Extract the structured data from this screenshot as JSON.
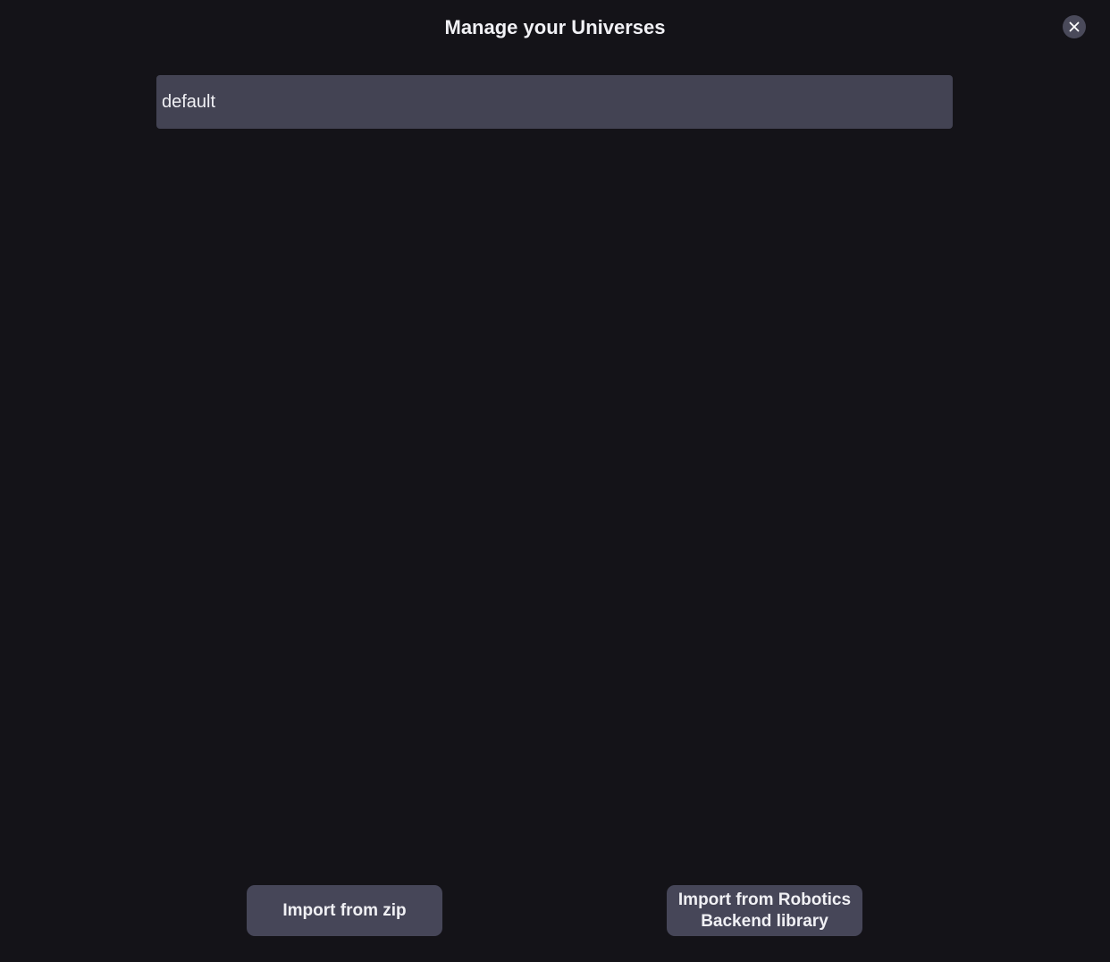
{
  "dialog": {
    "title": "Manage your Universes",
    "close_icon": "close-icon"
  },
  "universes": [
    {
      "name": "default"
    }
  ],
  "actions": {
    "import_zip_label": "Import from zip",
    "import_library_label": "Import from Robotics Backend library"
  },
  "colors": {
    "background": "#141318",
    "list_item": "#434353",
    "button": "#464658",
    "close_button": "#4a4a5a",
    "text": "#f0f0f4"
  }
}
